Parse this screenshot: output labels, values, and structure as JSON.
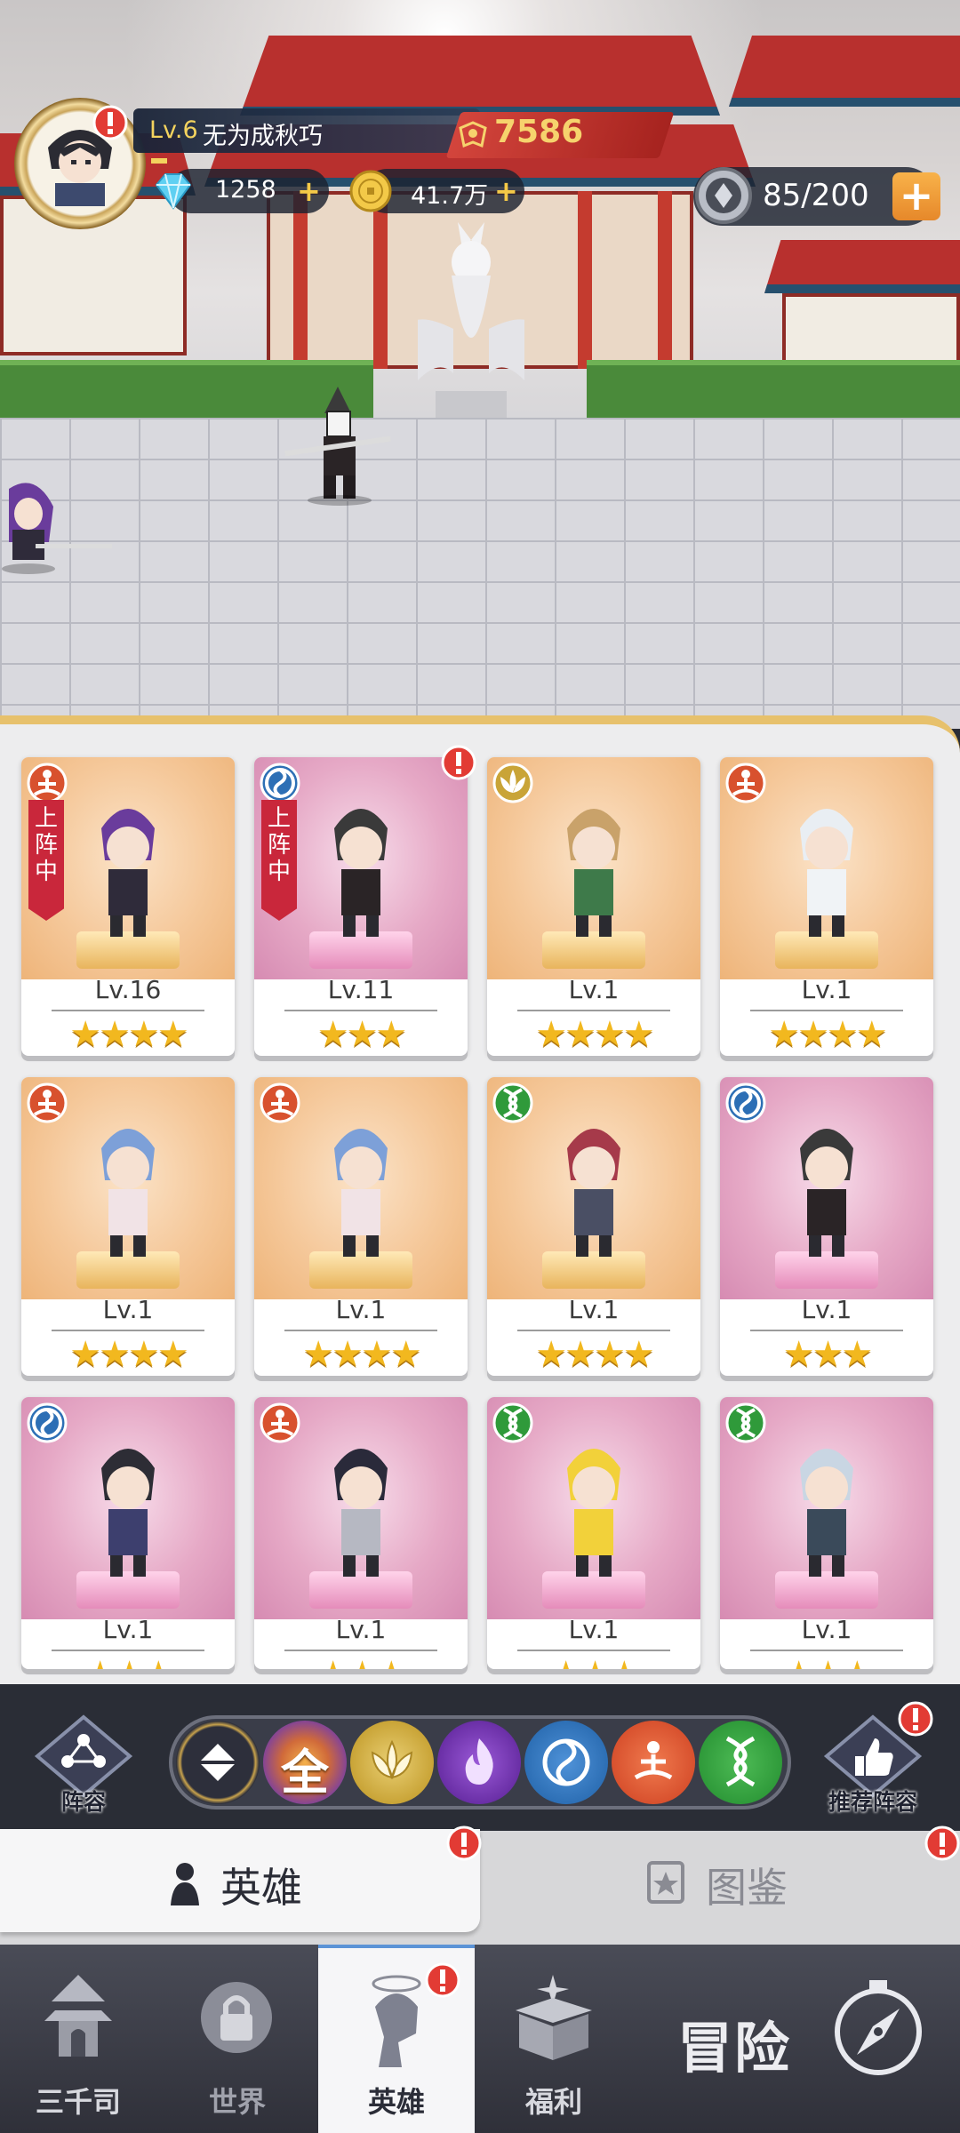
{
  "player": {
    "level": "Lv.6",
    "name": "无为成秋巧",
    "power": "7586",
    "gems": "1258",
    "gold": "41.7万",
    "stamina": "85/200"
  },
  "heroes": [
    {
      "level": "Lv.16",
      "stars": "★★★★",
      "element": "zen",
      "bg": "orange",
      "tag": "上阵中"
    },
    {
      "level": "Lv.11",
      "stars": "★★★",
      "element": "wave",
      "bg": "pink",
      "tag": "上阵中"
    },
    {
      "level": "Lv.1",
      "stars": "★★★★",
      "element": "lotus",
      "bg": "orange",
      "tag": ""
    },
    {
      "level": "Lv.1",
      "stars": "★★★★",
      "element": "zen",
      "bg": "orange",
      "tag": ""
    },
    {
      "level": "Lv.1",
      "stars": "★★★★",
      "element": "zen",
      "bg": "orange",
      "tag": ""
    },
    {
      "level": "Lv.1",
      "stars": "★★★★",
      "element": "zen",
      "bg": "orange",
      "tag": ""
    },
    {
      "level": "Lv.1",
      "stars": "★★★★",
      "element": "dna",
      "bg": "orange",
      "tag": ""
    },
    {
      "level": "Lv.1",
      "stars": "★★★",
      "element": "wave",
      "bg": "pink",
      "tag": ""
    },
    {
      "level": "Lv.1",
      "stars": "★★★",
      "element": "wave",
      "bg": "pink",
      "tag": ""
    },
    {
      "level": "Lv.1",
      "stars": "★★★",
      "element": "zen",
      "bg": "pink",
      "tag": ""
    },
    {
      "level": "Lv.1",
      "stars": "★★★",
      "element": "dna",
      "bg": "pink",
      "tag": ""
    },
    {
      "level": "Lv.1",
      "stars": "★★★",
      "element": "dna",
      "bg": "pink",
      "tag": ""
    }
  ],
  "lineup_button": "阵容",
  "recommend_button": "推荐阵容",
  "filters": {
    "all": "全",
    "icons": [
      "diamond-icon",
      "all-icon",
      "lotus-icon",
      "flame-icon",
      "wave-icon",
      "zen-icon",
      "dna-icon"
    ]
  },
  "subtabs": {
    "heroes": "英雄",
    "codex": "图鉴"
  },
  "nav": {
    "sanqiansi": "三千司",
    "world": "世界",
    "heroes": "英雄",
    "welfare": "福利",
    "adventure": "冒险"
  },
  "colors": {
    "accent_gold": "#f2b81f",
    "alert_red": "#e23b34",
    "power_red": "#c9322d",
    "tag_red": "#c9273b",
    "element_zen": "#d8512e",
    "element_wave": "#2d6fb5",
    "element_lotus": "#c9a437",
    "element_dna": "#2f9a3a",
    "element_flame": "#6a2fa6"
  }
}
